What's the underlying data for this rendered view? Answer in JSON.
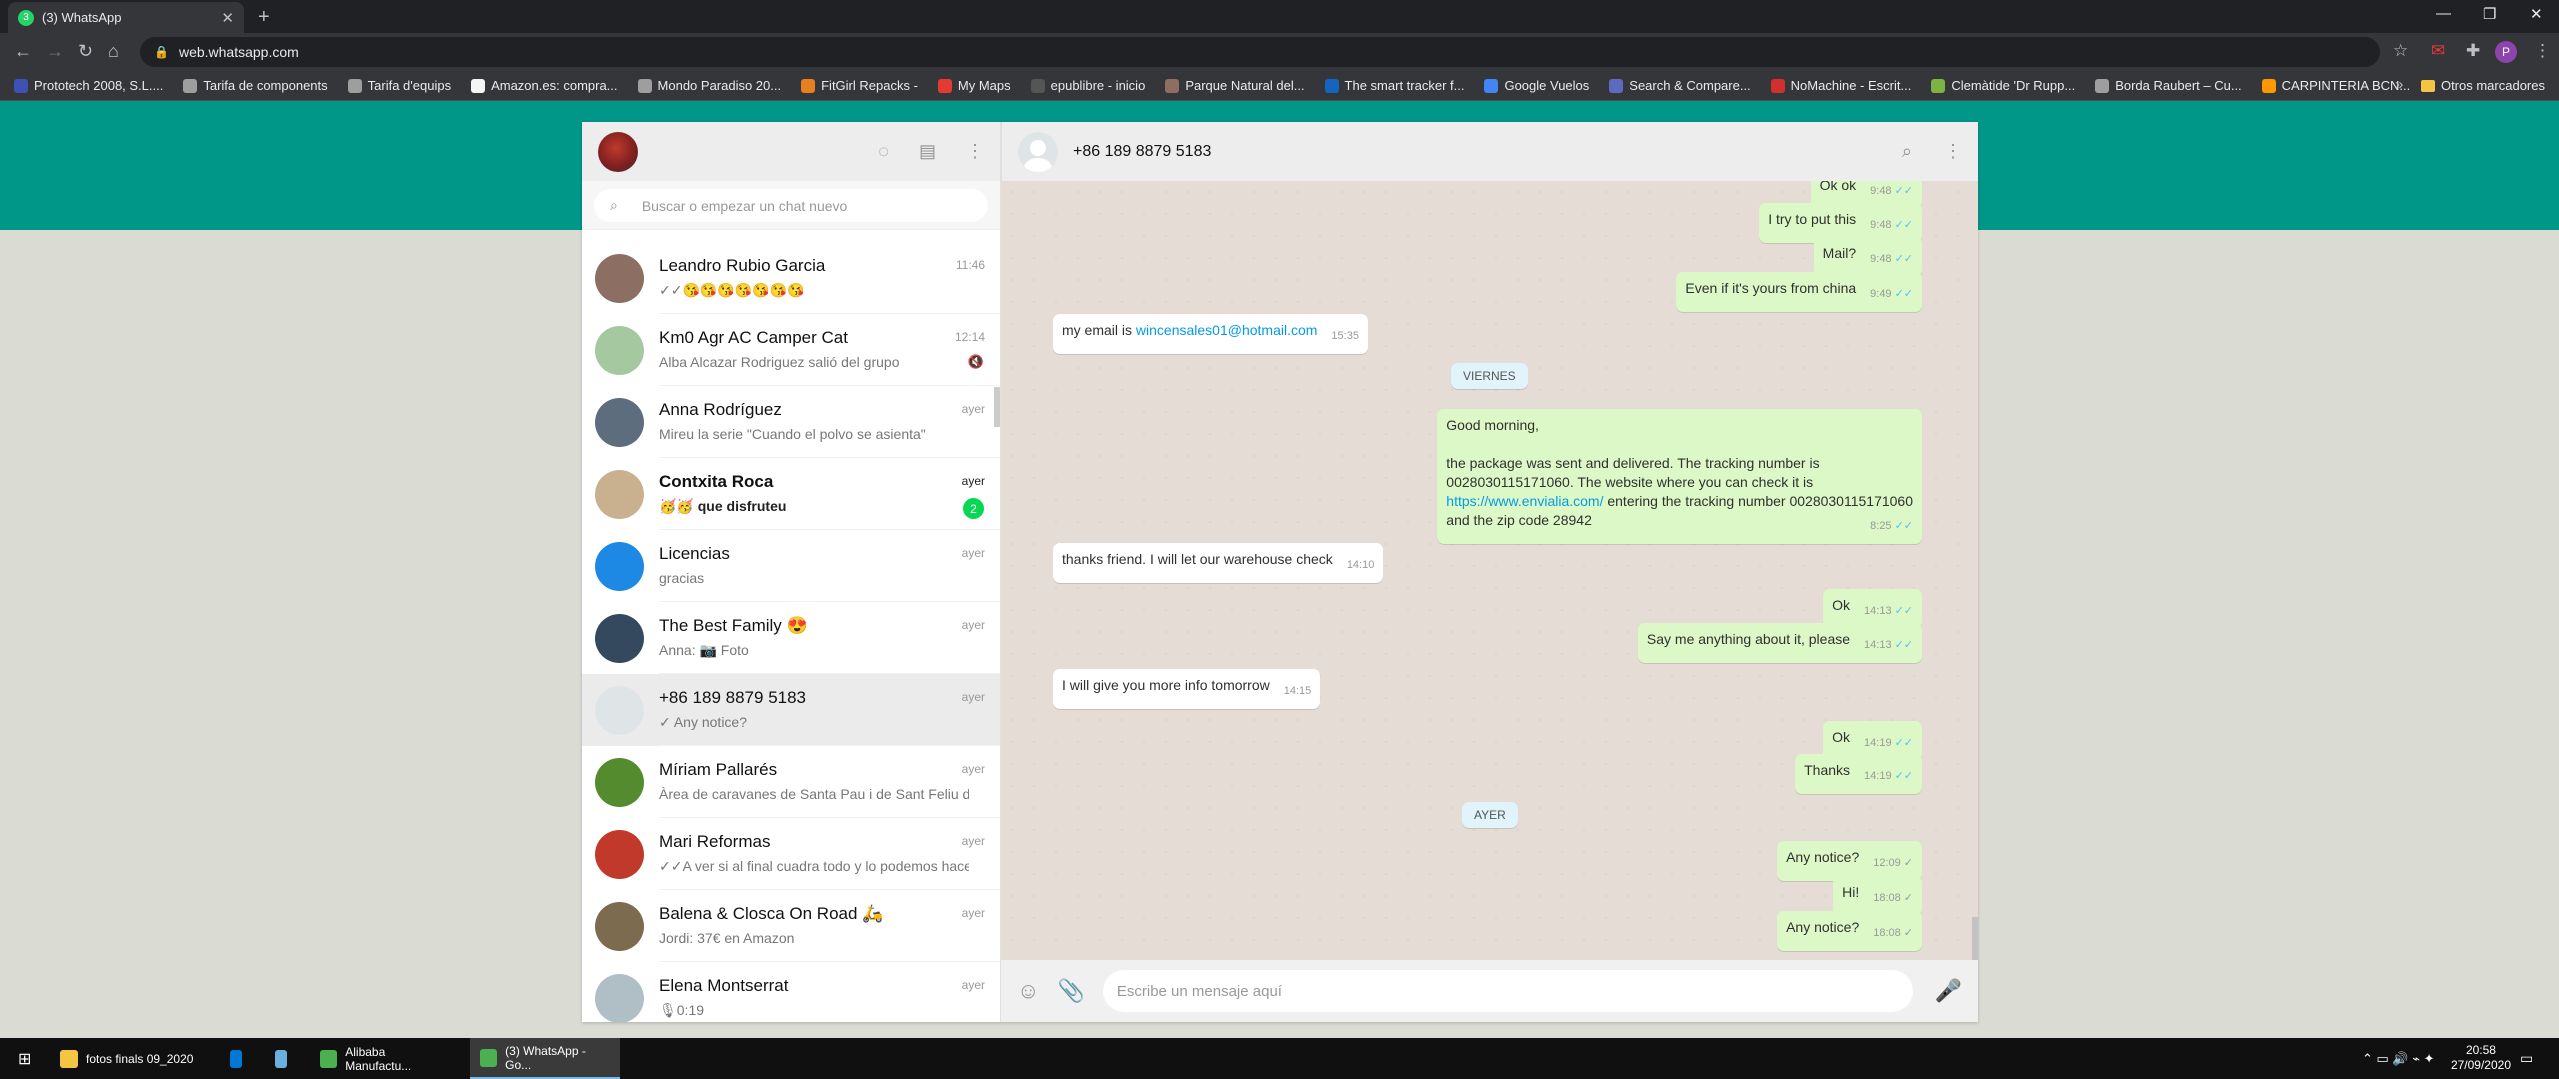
{
  "browser": {
    "tab_title": "(3) WhatsApp",
    "tab_favicon_text": "3",
    "url": "web.whatsapp.com",
    "profile_initial": "P",
    "extension_badge": "7",
    "bookmarks": [
      {
        "label": "Prototech 2008, S.L....",
        "color": "#3f51b5"
      },
      {
        "label": "Tarifa de components",
        "color": "#9e9e9e"
      },
      {
        "label": "Tarifa d'equips",
        "color": "#9e9e9e"
      },
      {
        "label": "Amazon.es: compra...",
        "color": "#f5f5f5"
      },
      {
        "label": "Mondo Paradiso 20...",
        "color": "#9e9e9e"
      },
      {
        "label": "FitGirl Repacks -",
        "color": "#e67e22"
      },
      {
        "label": "My Maps",
        "color": "#e53935"
      },
      {
        "label": "epublibre - inicio",
        "color": "#555"
      },
      {
        "label": "Parque Natural del...",
        "color": "#8d6e63"
      },
      {
        "label": "The smart tracker f...",
        "color": "#1565c0"
      },
      {
        "label": "Google Vuelos",
        "color": "#4285f4"
      },
      {
        "label": "Search & Compare...",
        "color": "#5c6bc0"
      },
      {
        "label": "NoMachine - Escrit...",
        "color": "#d32f2f"
      },
      {
        "label": "Clemàtide 'Dr Rupp...",
        "color": "#7cb342"
      },
      {
        "label": "Borda Raubert – Cu...",
        "color": "#9e9e9e"
      },
      {
        "label": "CARPINTERIA BCN...",
        "color": "#ff9800"
      }
    ],
    "other_bookmarks": "Otros marcadores"
  },
  "sidebar": {
    "search_placeholder": "Buscar o empezar un chat nuevo",
    "chats": [
      {
        "name": "Leandro Rubio Garcia",
        "last": "✓✓😘😘😘😘😘😘😘",
        "time": "11:46",
        "pic": "#8d6e63",
        "bold": false,
        "badge": "",
        "muted": false,
        "active": false
      },
      {
        "name": "Km0 Agr AC Camper Cat",
        "last": "Alba Alcazar Rodriguez salió del grupo",
        "time": "12:14",
        "pic": "#a5c8a0",
        "bold": false,
        "badge": "",
        "muted": true,
        "active": false
      },
      {
        "name": "Anna Rodríguez",
        "last": "Mirеu la serie \"Cuando el polvo se asienta\"",
        "time": "ayer",
        "pic": "#5d6d7e",
        "bold": false,
        "badge": "",
        "muted": false,
        "active": false
      },
      {
        "name": "Contxita Roca",
        "last": "🥳🥳 que disfruteu",
        "time": "ayer",
        "pic": "#c9b18f",
        "bold": true,
        "badge": "2",
        "muted": false,
        "active": false
      },
      {
        "name": "Licencias",
        "last": "gracias",
        "time": "ayer",
        "pic": "#1e88e5",
        "bold": false,
        "badge": "",
        "muted": false,
        "active": false
      },
      {
        "name": "The Best Family 😍",
        "last": "Anna: 📷 Foto",
        "time": "ayer",
        "pic": "#34495e",
        "bold": false,
        "badge": "",
        "muted": false,
        "active": false
      },
      {
        "name": "+86 189 8879 5183",
        "last": "✓ Any notice?",
        "time": "ayer",
        "pic": "#dfe5e7",
        "bold": false,
        "badge": "",
        "muted": false,
        "active": true
      },
      {
        "name": "Míriam Pallarés",
        "last": "Àrea de caravanes de Santa Pau i de Sant Feliu d...",
        "time": "ayer",
        "pic": "#558b2f",
        "bold": false,
        "badge": "",
        "muted": false,
        "active": false
      },
      {
        "name": "Mari Reformas",
        "last": "✓✓A ver si al final cuadra todo y lo podemos hacer",
        "time": "ayer",
        "pic": "#c0392b",
        "bold": false,
        "badge": "",
        "muted": false,
        "active": false
      },
      {
        "name": "Balena & Closca On Road 🛵",
        "last": "Jordi: 37€ en Amazon",
        "time": "ayer",
        "pic": "#7d6b4f",
        "bold": false,
        "badge": "",
        "muted": false,
        "active": false
      },
      {
        "name": "Elena Montserrat",
        "last": "🎙0:19",
        "time": "ayer",
        "pic": "#b0bec5",
        "bold": false,
        "badge": "",
        "muted": false,
        "active": false
      }
    ]
  },
  "conversation": {
    "contact": "+86 189 8879 5183",
    "compose_placeholder": "Escribe un mensaje aquí",
    "messages": [
      {
        "dir": "out",
        "text": "Ok ok",
        "time": "9:48"
      },
      {
        "dir": "out",
        "text": "I try to put this",
        "time": "9:48"
      },
      {
        "dir": "out",
        "text": "Mail?",
        "time": "9:48"
      },
      {
        "dir": "out",
        "text": "Even if it's yours from china",
        "time": "9:49"
      },
      {
        "dir": "in",
        "text": "my email is ",
        "link": "wincensales01@hotmail.com",
        "time": "15:35"
      },
      {
        "dir": "sep",
        "text": "VIERNES"
      },
      {
        "dir": "out",
        "lines": [
          "Good morning,",
          "",
          "the package was sent and delivered. The tracking number is",
          "0028030115171060. The website where you can check it is"
        ],
        "link": "https://www.envialia.com/",
        "after_link": " entering the tracking number 0028030115171060",
        "last_line": "and the zip code 28942",
        "time": "8:25"
      },
      {
        "dir": "in",
        "text": "thanks friend.  I will let our warehouse check",
        "time": "14:10"
      },
      {
        "dir": "out",
        "text": "Ok",
        "time": "14:13"
      },
      {
        "dir": "out",
        "text": "Say me anything about it, please",
        "time": "14:13"
      },
      {
        "dir": "in",
        "text": "I will give you more info tomorrow",
        "time": "14:15"
      },
      {
        "dir": "out",
        "text": "Ok",
        "time": "14:19"
      },
      {
        "dir": "out",
        "text": "Thanks",
        "time": "14:19"
      },
      {
        "dir": "sep",
        "text": "AYER"
      },
      {
        "dir": "out",
        "text": "Any notice?",
        "time": "12:09",
        "grey": true
      },
      {
        "dir": "out",
        "text": "Hi!",
        "time": "18:08",
        "grey": true
      },
      {
        "dir": "out",
        "text": "Any notice?",
        "time": "18:08",
        "grey": true
      }
    ]
  },
  "taskbar": {
    "items": [
      {
        "label": "fotos finals 09_2020",
        "color": "#f4c542"
      },
      {
        "label": "",
        "color": "#0078d4"
      },
      {
        "label": "",
        "color": "#6ab0de"
      },
      {
        "label": "Alibaba Manufactu...",
        "color": "#4caf50"
      },
      {
        "label": "(3) WhatsApp - Go...",
        "color": "#4caf50"
      }
    ],
    "time": "20:58",
    "date": "27/09/2020"
  }
}
